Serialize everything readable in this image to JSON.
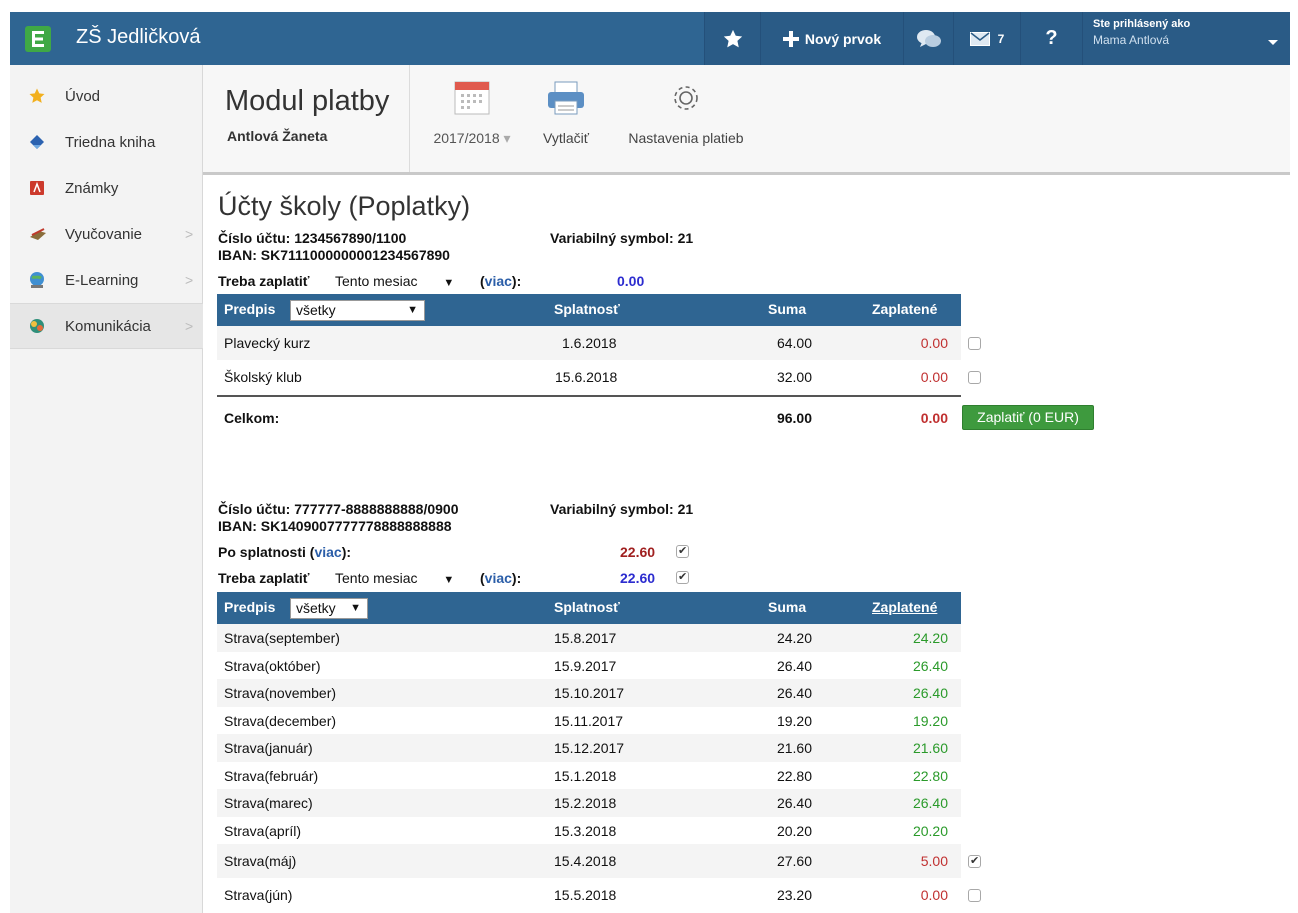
{
  "header": {
    "school_name": "ZŠ Jedličková",
    "new_item_label": "Nový prvok",
    "messages_count": "7",
    "help_label": "?",
    "user_label": "Ste prihlásený ako",
    "user_name": "Mama Antlová"
  },
  "sidebar": {
    "items": [
      {
        "label": "Úvod",
        "icon": "star-icon"
      },
      {
        "label": "Triedna kniha",
        "icon": "book-icon"
      },
      {
        "label": "Známky",
        "icon": "grades-icon"
      },
      {
        "label": "Vyučovanie",
        "icon": "teaching-icon",
        "has_chevron": true
      },
      {
        "label": "E-Learning",
        "icon": "elearning-icon",
        "has_chevron": true
      },
      {
        "label": "Komunikácia",
        "icon": "communication-icon",
        "has_chevron": true,
        "active": true
      }
    ],
    "chevron": ">"
  },
  "module": {
    "title": "Modul platby",
    "student": "Antlová Žaneta",
    "year_label": "2017/2018",
    "year_caret": "▾",
    "print_label": "Vytlačiť",
    "settings_label": "Nastavenia platieb"
  },
  "page_title": "Účty školy (Poplatky)",
  "account1": {
    "account_label": "Číslo účtu: 1234567890/1100",
    "iban_label": "IBAN: SK7111000000001234567890",
    "vs_label": "Variabilný symbol: 21",
    "need_pay_label": "Treba zaplatiť",
    "need_pay_period": "Tento mesiac",
    "more_open": "(",
    "more_link": "viac",
    "more_close": "):",
    "need_pay_value": "0.00",
    "table_headers": {
      "predpis": "Predpis",
      "filter": "všetky",
      "splatnost": "Splatnosť",
      "suma": "Suma",
      "zaplatene": "Zaplatené"
    },
    "rows": [
      {
        "name": "Plavecký kurz",
        "due": "1.6.2018",
        "amount": "64.00",
        "paid": "0.00",
        "checked": false
      },
      {
        "name": "Školský klub",
        "due": "15.6.2018",
        "amount": "32.00",
        "paid": "0.00",
        "checked": false
      }
    ],
    "total_label": "Celkom:",
    "total_amount": "96.00",
    "total_paid": "0.00",
    "pay_button": "Zaplatiť (0 EUR)"
  },
  "account2": {
    "account_label": "Číslo účtu: 777777-8888888888/0900",
    "iban_label": "IBAN: SK1409007777778888888888",
    "vs_label": "Variabilný symbol: 21",
    "overdue_label": "Po splatnosti",
    "overdue_value": "22.60",
    "need_pay_label": "Treba zaplatiť",
    "need_pay_period": "Tento mesiac",
    "more_open": "(",
    "more_link": "viac",
    "more_close": "):",
    "need_pay_value": "22.60",
    "table_headers": {
      "predpis": "Predpis",
      "filter": "všetky",
      "splatnost": "Splatnosť",
      "suma": "Suma",
      "zaplatene": "Zaplatené"
    },
    "rows": [
      {
        "name": "Strava(september)",
        "due": "15.8.2017",
        "amount": "24.20",
        "paid": "24.20",
        "status": "paid"
      },
      {
        "name": "Strava(október)",
        "due": "15.9.2017",
        "amount": "26.40",
        "paid": "26.40",
        "status": "paid"
      },
      {
        "name": "Strava(november)",
        "due": "15.10.2017",
        "amount": "26.40",
        "paid": "26.40",
        "status": "paid"
      },
      {
        "name": "Strava(december)",
        "due": "15.11.2017",
        "amount": "19.20",
        "paid": "19.20",
        "status": "paid"
      },
      {
        "name": "Strava(január)",
        "due": "15.12.2017",
        "amount": "21.60",
        "paid": "21.60",
        "status": "paid"
      },
      {
        "name": "Strava(február)",
        "due": "15.1.2018",
        "amount": "22.80",
        "paid": "22.80",
        "status": "paid"
      },
      {
        "name": "Strava(marec)",
        "due": "15.2.2018",
        "amount": "26.40",
        "paid": "26.40",
        "status": "paid"
      },
      {
        "name": "Strava(apríl)",
        "due": "15.3.2018",
        "amount": "20.20",
        "paid": "20.20",
        "status": "paid"
      },
      {
        "name": "Strava(máj)",
        "due": "15.4.2018",
        "amount": "27.60",
        "paid": "5.00",
        "status": "partial",
        "checked": true
      },
      {
        "name": "Strava(jún)",
        "due": "15.5.2018",
        "amount": "23.20",
        "paid": "0.00",
        "status": "unpaid",
        "checked": false
      }
    ]
  },
  "colors": {
    "topbar": "#2f6592",
    "paid": "#2a9a2a",
    "unpaid": "#c03030",
    "pay_button": "#3e9a3e",
    "link": "#2b5ea8"
  }
}
